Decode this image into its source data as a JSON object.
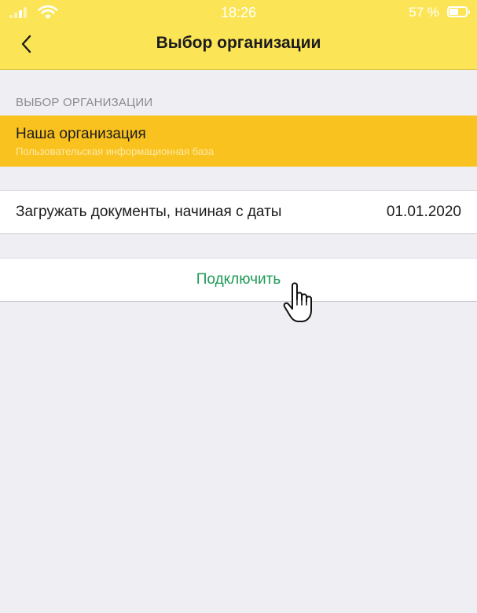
{
  "status_bar": {
    "time": "18:26",
    "battery_percent": "57 %",
    "battery_level": 0.57
  },
  "header": {
    "title": "Выбор организации",
    "back_icon": "chevron-left-icon"
  },
  "section": {
    "header": "ВЫБОР ОРГАНИЗАЦИИ"
  },
  "organization": {
    "name": "Наша организация",
    "description": "Пользовательская информационная база"
  },
  "date_setting": {
    "label": "Загружать документы, начиная с даты",
    "value": "01.01.2020"
  },
  "connect": {
    "label": "Подключить"
  },
  "colors": {
    "header_bg": "#fbe556",
    "selected_row": "#f9c21e",
    "connect_text": "#1f9a57",
    "background": "#efeff3"
  }
}
